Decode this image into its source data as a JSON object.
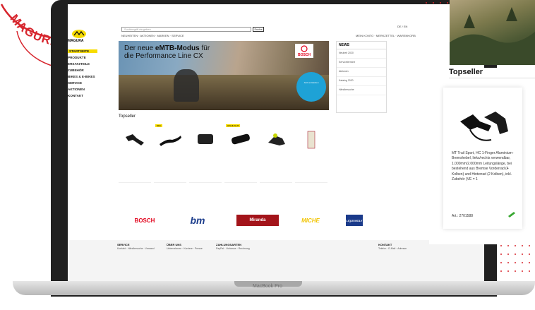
{
  "stamp": {
    "text": "MAGURA ORIGINAL",
    "color": "#d7262e"
  },
  "laptop": {
    "model": "MacBook Pro"
  },
  "site": {
    "logo": "MAGURA",
    "nav": [
      "STARTSEITE",
      "PRODUKTE",
      "ERSATZTEILE",
      "ZUBEHÖR",
      "BIKES & E-BIKES",
      "SERVICE",
      "AKTIONEN",
      "KONTAKT"
    ],
    "search_placeholder": "Suchbegriff eingeben",
    "search_button": "Suche",
    "topnav": "NEUHEITEN · AKTIONEN · MARKEN · SERVICE",
    "utilnav": "MEIN KONTO · MERKZETTEL · WARENKORB",
    "lang": "DE / EN",
    "hero_line1_pre": "Der neue ",
    "hero_line1_bold": "eMTB-Modus",
    "hero_line1_post": " für",
    "hero_line2": "die Performance Line CX",
    "hero_badge": "BOSCH",
    "hero_circle": "Jetzt entdecken",
    "news_title": "NEWS",
    "news_items": [
      "Neuheit 2020",
      "Servicetermine",
      "Aktionen",
      "Katalog 2020",
      "Händlersuche"
    ],
    "topseller_title": "Topseller",
    "brands": [
      "BOSCH",
      "bm",
      "Miranda",
      "MICHE",
      "LIQUI MOLY"
    ],
    "footer": {
      "col1_title": "SERVICE",
      "col1": "Kontakt · Händlersuche · Versand",
      "col2_title": "ÜBER UNS",
      "col2": "Unternehmen · Karriere · Presse",
      "col3_title": "ZAHLUNGSARTEN",
      "col3": "PayPal · Vorkasse · Rechnung",
      "col4_title": "KONTAKT",
      "col4": "Telefon · E-Mail · Adresse"
    }
  },
  "overlay": {
    "topseller": "Topseller",
    "product_text": "MT Trail Sport, HC 1-Finger Aluminium-Bremshebel, links/rechts verwendbar, 1.000mm/2.000mm Leitungslänge, bei bestehend aus Bremse Vorderrad (4 Kolben) und Hinterrad (2 Kolben), inkl. Zubehör (VE = 1",
    "article": "Art.: 2701588"
  }
}
